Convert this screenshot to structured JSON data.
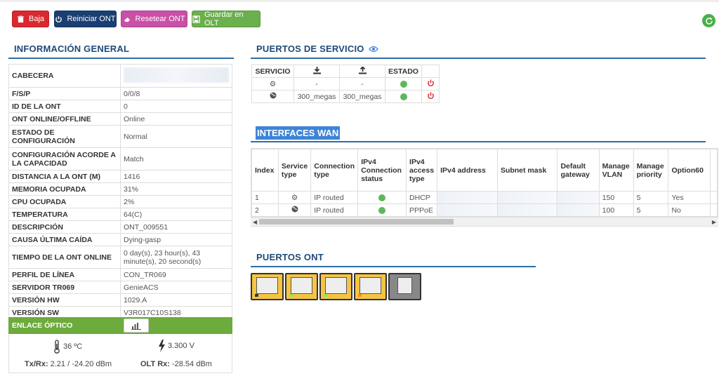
{
  "toolbar": {
    "baja": "Baja",
    "reiniciar": "Reiniciar ONT",
    "resetear": "Resetear ONT",
    "guardar": "Guardar en OLT"
  },
  "info_general": {
    "title": "INFORMACIÓN GENERAL",
    "rows": [
      {
        "k": "CABECERA",
        "v": ""
      },
      {
        "k": "F/S/P",
        "v": "0/0/8"
      },
      {
        "k": "ID DE LA ONT",
        "v": "0"
      },
      {
        "k": "ONT ONLINE/OFFLINE",
        "v": "Online"
      },
      {
        "k": "ESTADO DE CONFIGURACIÓN",
        "v": "Normal"
      },
      {
        "k": "CONFIGURACIÓN ACORDE A LA CAPACIDAD",
        "v": "Match"
      },
      {
        "k": "DISTANCIA A LA ONT (M)",
        "v": "1416"
      },
      {
        "k": "MEMORIA OCUPADA",
        "v": "31%"
      },
      {
        "k": "CPU OCUPADA",
        "v": "2%"
      },
      {
        "k": "TEMPERATURA",
        "v": "64(C)"
      },
      {
        "k": "DESCRIPCIÓN",
        "v": "ONT_009551"
      },
      {
        "k": "CAUSA ÚLTIMA CAÍDA",
        "v": "Dying-gasp"
      },
      {
        "k": "TIEMPO DE LA ONT ONLINE",
        "v": "0 day(s), 23 hour(s), 43 minute(s), 20 second(s)"
      },
      {
        "k": "PERFIL DE LÍNEA",
        "v": "CON_TR069"
      },
      {
        "k": "SERVIDOR TR069",
        "v": "GenieACS"
      },
      {
        "k": "VERSIÓN HW",
        "v": "1029.A"
      },
      {
        "k": "VERSIÓN SW",
        "v": "V3R017C10S138"
      }
    ],
    "enlace_optico": "ENLACE ÓPTICO",
    "temperatura": "36 ºC",
    "voltaje": "3.300 V",
    "txrx_label": "Tx/Rx:",
    "txrx_value": "2.21 / -24.20 dBm",
    "olt_rx_label": "OLT Rx:",
    "olt_rx_value": "-28.54 dBm"
  },
  "puertos_servicio": {
    "title": "PUERTOS DE SERVICIO",
    "headers": {
      "servicio": "SERVICIO",
      "estado": "ESTADO"
    },
    "rows": [
      {
        "icon": "gear-icon",
        "down": "-",
        "up": "-"
      },
      {
        "icon": "globe-icon",
        "down": "300_megas",
        "up": "300_megas"
      }
    ]
  },
  "interfaces_wan": {
    "title": "INTERFACES WAN",
    "headers": [
      "Index",
      "Service type",
      "Connection type",
      "IPv4 Connection status",
      "IPv4 access type",
      "IPv4 address",
      "Subnet mask",
      "Default gateway",
      "Manage VLAN",
      "Manage priority",
      "Option60"
    ],
    "rows": [
      {
        "index": "1",
        "service_icon": "gear-icon",
        "conn": "IP routed",
        "access": "DHCP",
        "vlan": "150",
        "prio": "5",
        "opt60": "Yes"
      },
      {
        "index": "2",
        "service_icon": "globe-icon",
        "conn": "IP routed",
        "access": "PPPoE",
        "vlan": "100",
        "prio": "5",
        "opt60": "No"
      }
    ]
  },
  "puertos_ont": {
    "title": "PUERTOS ONT",
    "ports": [
      {
        "state": "active",
        "led": "#3a3a3a"
      },
      {
        "state": "active",
        "led": "#9be05a"
      },
      {
        "state": "active",
        "led": "#9be05a"
      },
      {
        "state": "active",
        "led": "#f0902a"
      },
      {
        "state": "idle",
        "led": ""
      }
    ]
  },
  "colors": {
    "danger": "#d9282f",
    "primary": "#1a3f73",
    "pink": "#c94fa7",
    "success": "#6ab04c",
    "heading": "#1d4a78"
  }
}
